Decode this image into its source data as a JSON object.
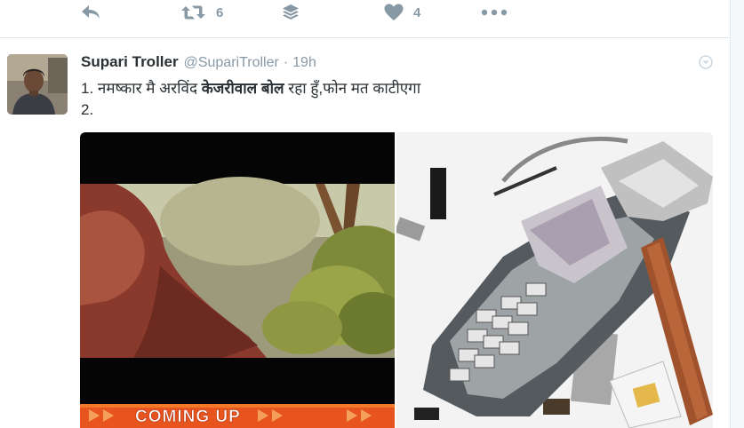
{
  "prev_tweet_actions": {
    "retweet_count": "6",
    "like_count": "4"
  },
  "tweet": {
    "fullname": "Supari Troller",
    "username": "@SupariTroller",
    "separator": "·",
    "time": "19h",
    "line1_prefix": "1. नमष्कार मै अरविंद ",
    "line1_bold": "केजरीवाल बोल",
    "line1_suffix": " रहा हुँ,फोन मत काटीएगा",
    "line2": "2."
  },
  "media": {
    "left_banner_text": "COMING UP"
  },
  "icons": {
    "reply": "reply-icon",
    "retweet": "retweet-icon",
    "stack": "stack-icon",
    "like": "heart-icon",
    "more": "more-dots-icon",
    "caret": "dropdown-caret-icon"
  },
  "colors": {
    "icon_gray": "#8899a6",
    "divider": "#e1e8ed",
    "banner_orange": "#e8541e"
  }
}
